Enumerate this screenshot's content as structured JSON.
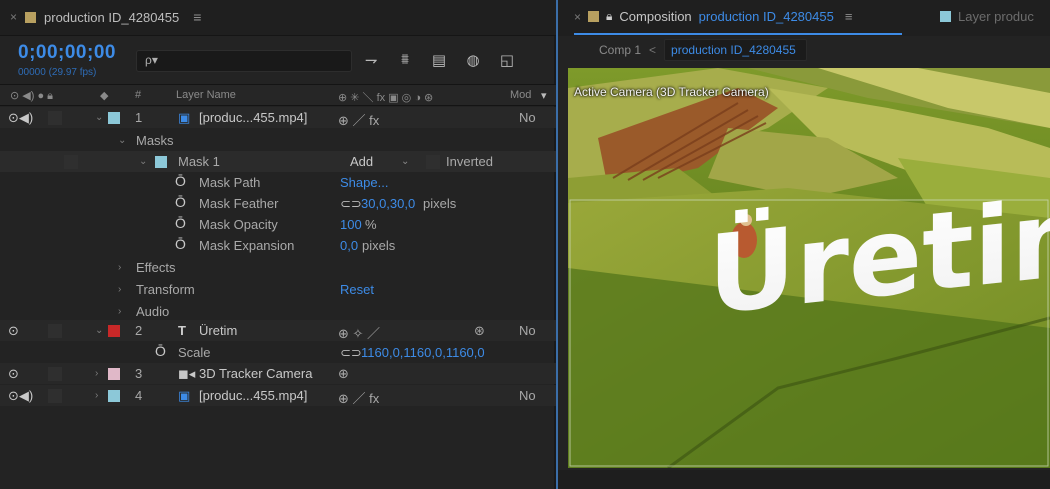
{
  "timeline": {
    "tab_close": "×",
    "tab_title": "production ID_4280455",
    "tab_menu": "≡",
    "tab_swatch_color": "#b8a060",
    "timecode": "0;00;00;00",
    "frames": "00000 (29.97 fps)",
    "search_icon": "ρ▾",
    "header": {
      "layer_name": "Layer Name",
      "hash": "#",
      "mode": "Mod"
    },
    "rows": [
      {
        "number": "1",
        "name": "[produc...455.mp4]",
        "switches": "⊕  ／ fx",
        "mode": "No",
        "color": "#8cc8d8"
      },
      {
        "label": "Masks"
      },
      {
        "label": "Mask 1",
        "mode_value": "Add",
        "inverted_label": "Inverted",
        "color": "#8cc8d8"
      },
      {
        "label": "Mask Path",
        "value": "Shape..."
      },
      {
        "label": "Mask Feather",
        "value": "30,0,30,0",
        "unit": "pixels"
      },
      {
        "label": "Mask Opacity",
        "value": "100",
        "unit": "%"
      },
      {
        "label": "Mask Expansion",
        "value": "0,0",
        "unit": "pixels"
      },
      {
        "label": "Effects"
      },
      {
        "label": "Transform",
        "value": "Reset"
      },
      {
        "label": "Audio"
      },
      {
        "number": "2",
        "type_icon": "T",
        "name": "Üretim",
        "mode": "No",
        "color": "#c82828"
      },
      {
        "label": "Scale",
        "value": "1160,0,1160,0,1160,0"
      },
      {
        "number": "3",
        "name": "3D Tracker Camera",
        "color": "#e0b8c8"
      },
      {
        "number": "4",
        "name": "[produc...455.mp4]",
        "switches": "⊕  ／ fx",
        "mode": "No",
        "color": "#8cc8d8"
      }
    ]
  },
  "composition": {
    "tab_close": "×",
    "tab_label": "Composition",
    "tab_comp_name": "production ID_4280455",
    "tab_menu": "≡",
    "layer_tab": "Layer produc",
    "breadcrumb_first": "Comp 1",
    "breadcrumb_sep": "<",
    "breadcrumb_current": "production ID_4280455",
    "active_camera": "Active Camera (3D Tracker Camera)",
    "overlay_text": "Üretim"
  },
  "colors": {
    "accent": "#3d8be6",
    "text_label_red": "#c82828",
    "footage_blue": "#8cc8d8",
    "camera_pink": "#e0b8c8"
  }
}
